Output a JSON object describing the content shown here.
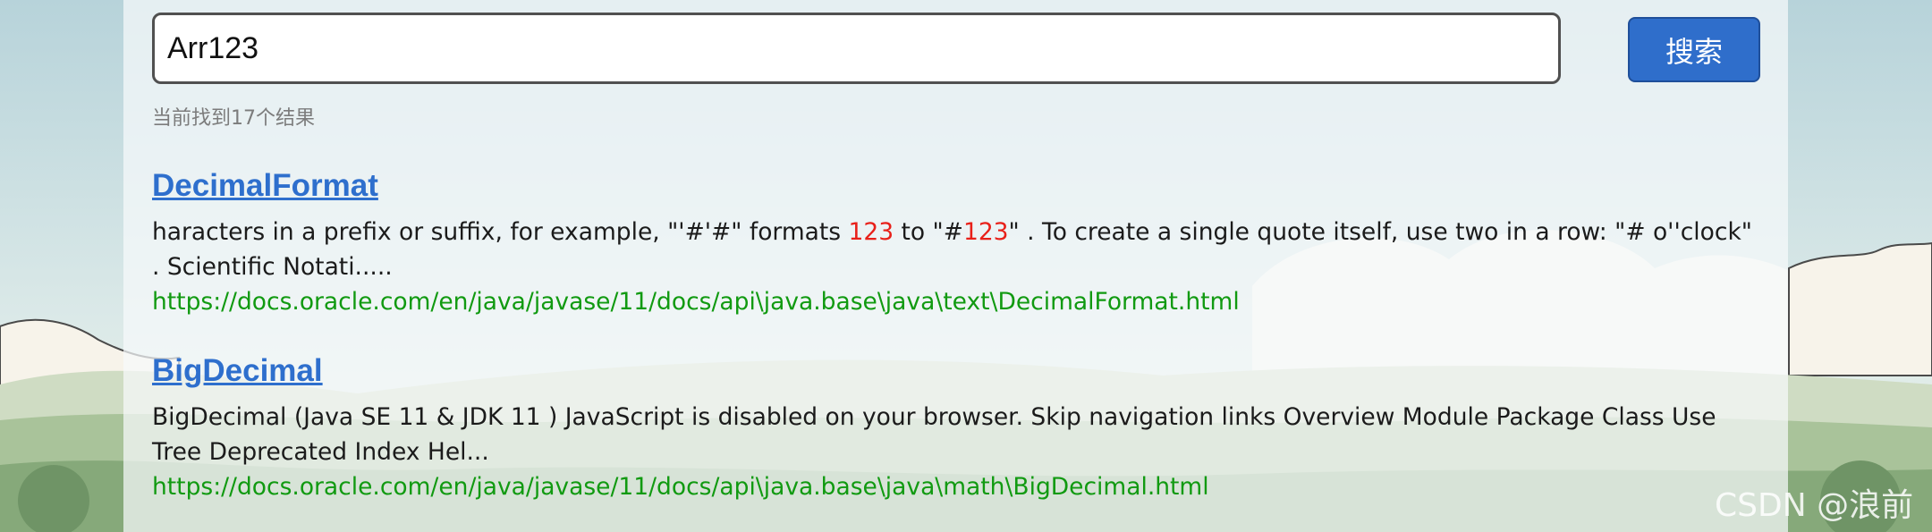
{
  "search": {
    "value": "Arr123",
    "button_label": "搜索"
  },
  "result_count_text": "当前找到17个结果",
  "results": [
    {
      "title": "DecimalFormat",
      "snippet_parts": [
        "haracters in a prefix or suffix, for example, \"'#'#\" formats ",
        "123",
        " to \"#",
        "123",
        "\" . To create a single quote itself, use two in a row: \"# o''clock\" . Scientific Notati....."
      ],
      "url": "https://docs.oracle.com/en/java/javase/11/docs/api\\java.base\\java\\text\\DecimalFormat.html"
    },
    {
      "title": "BigDecimal",
      "snippet_parts": [
        "BigDecimal (Java SE 11 & JDK 11 ) JavaScript is disabled on your browser. Skip navigation links Overview Module Package Class Use Tree Deprecated Index Hel..."
      ],
      "url": "https://docs.oracle.com/en/java/javase/11/docs/api\\java.base\\java\\math\\BigDecimal.html"
    }
  ],
  "watermark": "CSDN @浪前",
  "colors": {
    "link": "#2e6fcd",
    "url": "#119a11",
    "highlight": "#e8201a",
    "button": "#2f6ecb"
  }
}
